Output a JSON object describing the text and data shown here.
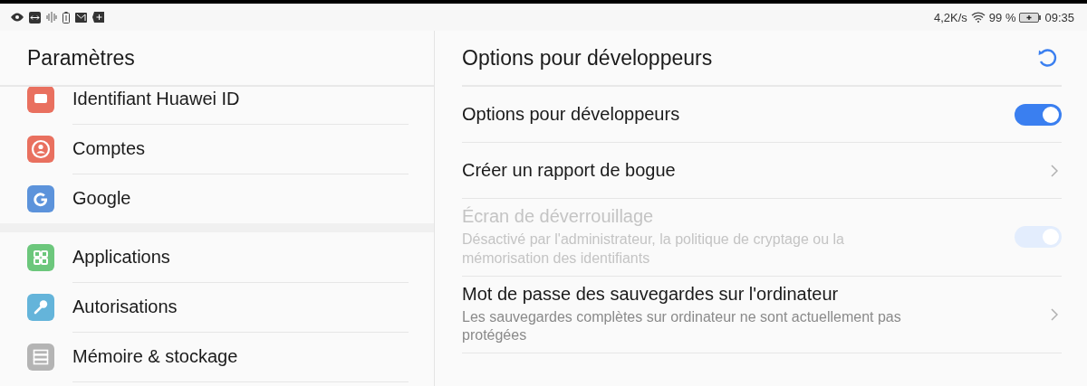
{
  "status_bar": {
    "net_speed": "4,2K/s",
    "battery": "99 %",
    "time": "09:35",
    "charging": true
  },
  "sidebar": {
    "title": "Paramètres",
    "groups": [
      [
        {
          "label": "Identifiant Huawei ID",
          "kind": "id",
          "color": "#e9705f",
          "clipped": true
        },
        {
          "label": "Comptes",
          "kind": "account",
          "color": "#e9705f",
          "clipped": false
        },
        {
          "label": "Google",
          "kind": "google",
          "color": "#5c93db",
          "clipped": false
        }
      ],
      [
        {
          "label": "Applications",
          "kind": "apps",
          "color": "#6cc77c",
          "clipped": false
        },
        {
          "label": "Autorisations",
          "kind": "key",
          "color": "#64b4da",
          "clipped": false
        },
        {
          "label": "Mémoire & stockage",
          "kind": "storage",
          "color": "#b4b4b4",
          "clipped": false
        }
      ]
    ]
  },
  "panel": {
    "title": "Options pour développeurs",
    "loading": true,
    "items": [
      {
        "kind": "toggle",
        "title": "Options pour développeurs",
        "on": true,
        "disabled": false
      },
      {
        "kind": "link",
        "title": "Créer un rapport de bogue",
        "disabled": false
      },
      {
        "kind": "toggle",
        "title": "Écran de déverrouillage",
        "subtitle": "Désactivé par l'administrateur, la politique de cryptage ou la mémorisation des identifiants",
        "on": true,
        "disabled": true
      },
      {
        "kind": "link",
        "title": "Mot de passe des sauvegardes sur l'ordinateur",
        "subtitle": "Les sauvegardes complètes sur ordinateur ne sont actuellement pas protégées",
        "disabled": false
      }
    ]
  }
}
